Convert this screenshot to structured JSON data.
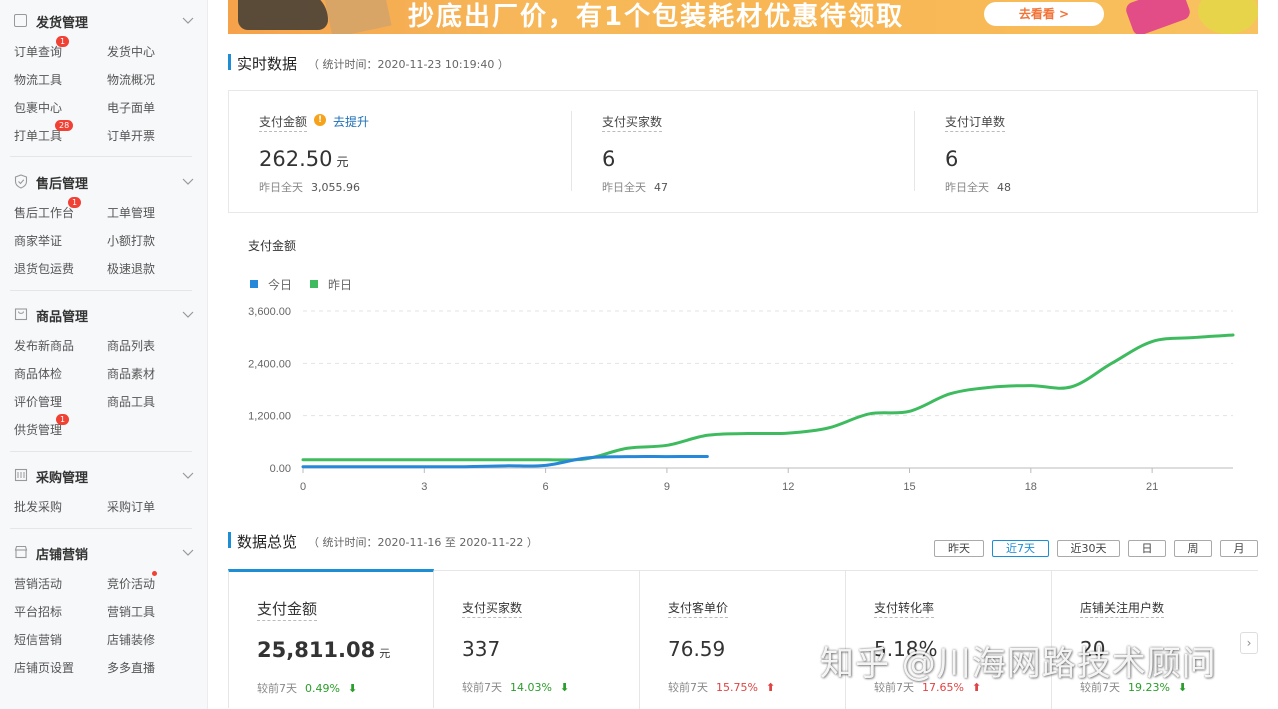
{
  "sidebar": {
    "groups": [
      {
        "title": "发货管理",
        "icon": "document-icon",
        "items": [
          {
            "label": "订单查询",
            "badge": "1"
          },
          {
            "label": "发货中心"
          },
          {
            "label": "物流工具"
          },
          {
            "label": "物流概况"
          },
          {
            "label": "包裹中心"
          },
          {
            "label": "电子面单"
          },
          {
            "label": "打单工具",
            "badge": "28"
          },
          {
            "label": "订单开票"
          }
        ]
      },
      {
        "title": "售后管理",
        "icon": "shield-icon",
        "items": [
          {
            "label": "售后工作台",
            "badge": "1"
          },
          {
            "label": "工单管理"
          },
          {
            "label": "商家举证"
          },
          {
            "label": "小额打款"
          },
          {
            "label": "退货包运费"
          },
          {
            "label": "极速退款"
          }
        ]
      },
      {
        "title": "商品管理",
        "icon": "bag-icon",
        "items": [
          {
            "label": "发布新商品"
          },
          {
            "label": "商品列表"
          },
          {
            "label": "商品体检"
          },
          {
            "label": "商品素材"
          },
          {
            "label": "评价管理"
          },
          {
            "label": "商品工具"
          },
          {
            "label": "供货管理",
            "badge": "1"
          }
        ]
      },
      {
        "title": "采购管理",
        "icon": "cart-icon",
        "items": [
          {
            "label": "批发采购"
          },
          {
            "label": "采购订单"
          }
        ]
      },
      {
        "title": "店铺营销",
        "icon": "shop-icon",
        "items": [
          {
            "label": "营销活动"
          },
          {
            "label": "竞价活动",
            "dot": true
          },
          {
            "label": "平台招标"
          },
          {
            "label": "营销工具"
          },
          {
            "label": "短信营销"
          },
          {
            "label": "店铺装修"
          },
          {
            "label": "店铺页设置"
          },
          {
            "label": "多多直播"
          }
        ]
      }
    ]
  },
  "banner": {
    "text": "抄底出厂价，有1个包装耗材优惠待领取",
    "button": "去看看 >"
  },
  "realtime": {
    "title": "实时数据",
    "subtitle": "（ 统计时间：2020-11-23 10:19:40 ）",
    "metrics": [
      {
        "label": "支付金额",
        "value": "262.50",
        "unit": "元",
        "yesterday_label": "昨日全天",
        "yesterday_value": "3,055.96",
        "tip": "去提升"
      },
      {
        "label": "支付买家数",
        "value": "6",
        "unit": "",
        "yesterday_label": "昨日全天",
        "yesterday_value": "47"
      },
      {
        "label": "支付订单数",
        "value": "6",
        "unit": "",
        "yesterday_label": "昨日全天",
        "yesterday_value": "48"
      }
    ]
  },
  "chart_data": {
    "type": "line",
    "title": "支付金额",
    "x_ticks": [
      0,
      3,
      6,
      9,
      12,
      15,
      18,
      21
    ],
    "xlim": [
      0,
      23
    ],
    "y_ticks": [
      "0.00",
      "1,200.00",
      "2,400.00",
      "3,600.00"
    ],
    "ylim": [
      0,
      3600
    ],
    "legend_position": "top-left",
    "series": [
      {
        "name": "今日",
        "color": "#2688d8",
        "x": [
          0,
          1,
          2,
          3,
          4,
          5,
          6,
          7,
          8,
          9,
          10
        ],
        "y": [
          30,
          30,
          30,
          30,
          30,
          50,
          60,
          230,
          260,
          262,
          262.5
        ]
      },
      {
        "name": "昨日",
        "color": "#3dbb5e",
        "x": [
          0,
          1,
          2,
          3,
          4,
          5,
          6,
          7,
          8,
          9,
          10,
          11,
          12,
          13,
          14,
          15,
          16,
          17,
          18,
          19,
          20,
          21,
          22,
          23
        ],
        "y": [
          190,
          190,
          190,
          190,
          190,
          190,
          190,
          210,
          450,
          520,
          750,
          790,
          800,
          920,
          1240,
          1300,
          1700,
          1850,
          1890,
          1860,
          2400,
          2900,
          2990,
          3050
        ]
      }
    ]
  },
  "overview": {
    "title": "数据总览",
    "subtitle": "（ 统计时间：2020-11-16 至 2020-11-22 ）",
    "ranges": [
      "昨天",
      "近7天",
      "近30天",
      "日",
      "周",
      "月"
    ],
    "active_range": "近7天",
    "cards": [
      {
        "label": "支付金额",
        "value": "25,811.08",
        "unit": "元",
        "cmp_label": "较前7天",
        "pct": "0.49%",
        "dir": "down"
      },
      {
        "label": "支付买家数",
        "value": "337",
        "unit": "",
        "cmp_label": "较前7天",
        "pct": "14.03%",
        "dir": "down"
      },
      {
        "label": "支付客单价",
        "value": "76.59",
        "unit": "",
        "cmp_label": "较前7天",
        "pct": "15.75%",
        "dir": "up"
      },
      {
        "label": "支付转化率",
        "value": "5.18%",
        "unit": "",
        "cmp_label": "较前7天",
        "pct": "17.65%",
        "dir": "up"
      },
      {
        "label": "店铺关注用户数",
        "value": "20",
        "unit": "",
        "cmp_label": "较前7天",
        "pct": "19.23%",
        "dir": "down"
      }
    ]
  },
  "watermark": "知乎 @川海网路技术顾问",
  "colors": {
    "accent": "#1b8ed6",
    "up": "#e04343",
    "down": "#2a9d2a",
    "badge": "#f04134"
  }
}
